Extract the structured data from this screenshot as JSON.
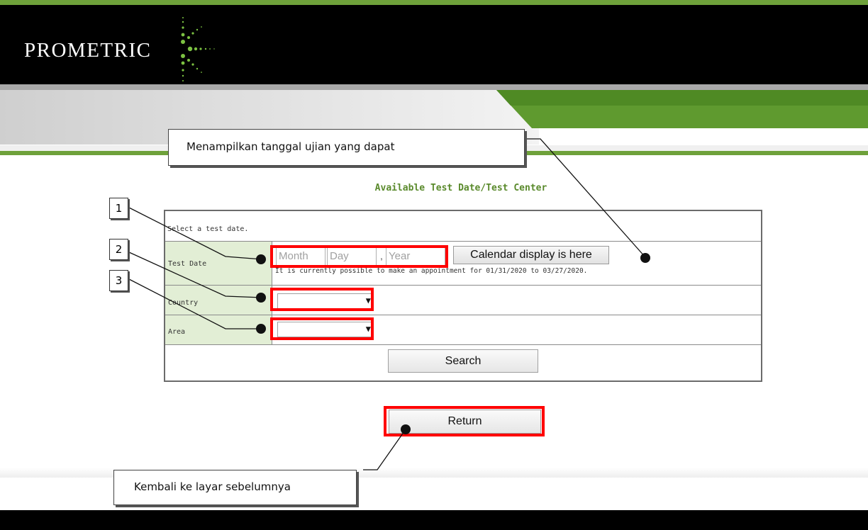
{
  "header": {
    "logo_text": "PROMETRIC",
    "brand_green": "#6ea13a"
  },
  "page_title": "Available Test Date/Test Center",
  "form": {
    "intro": "Select a test date.",
    "test_date": {
      "label": "Test Date",
      "month_placeholder": "Month",
      "day_placeholder": "Day",
      "separator": ",",
      "year_placeholder": "Year",
      "calendar_button": "Calendar display is here",
      "note": "It is currently possible to make an appointment for 01/31/2020 to 03/27/2020."
    },
    "country": {
      "label": "Country",
      "value": ""
    },
    "area": {
      "label": "Area",
      "value": ""
    },
    "search_button": "Search"
  },
  "return_button": "Return",
  "annotations": {
    "callout_top": "Menampilkan tanggal ujian yang dapat",
    "callout_bottom": "Kembali ke layar sebelumnya",
    "number_1": "1",
    "number_2": "2",
    "number_3": "3",
    "highlight_color": "#ff0000"
  }
}
